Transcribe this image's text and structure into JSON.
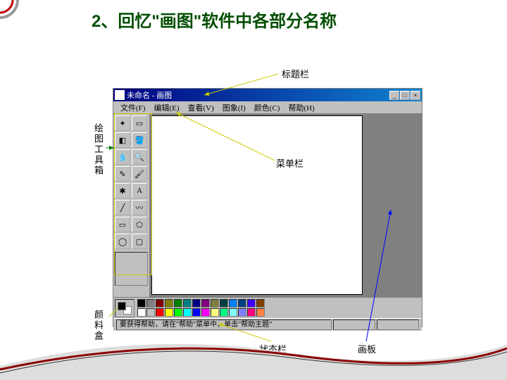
{
  "slide": {
    "title": "2、回忆\"画图\"软件中各部分名称"
  },
  "window": {
    "title": "未命名 - 画图"
  },
  "menu": {
    "file": "文件(F)",
    "edit": "编辑(E)",
    "view": "查看(V)",
    "image": "图象(I)",
    "color": "颜色(C)",
    "help": "帮助(H)"
  },
  "status": {
    "text": "要获得帮助，请在\"帮助\"菜单中，单击\"帮助主题\""
  },
  "annotations": {
    "titlebar": "标题栏",
    "menubar": "菜单栏",
    "toolbox": "绘图工具箱",
    "palette": "颜料盒",
    "statusbar": "状态栏",
    "canvas": "画板"
  },
  "palette_colors_row1": [
    "#000000",
    "#808080",
    "#800000",
    "#808000",
    "#008000",
    "#008080",
    "#000080",
    "#800080",
    "#808040",
    "#004040",
    "#0080ff",
    "#004080",
    "#4000ff",
    "#804000"
  ],
  "palette_colors_row2": [
    "#ffffff",
    "#c0c0c0",
    "#ff0000",
    "#ffff00",
    "#00ff00",
    "#00ffff",
    "#0000ff",
    "#ff00ff",
    "#ffff80",
    "#00ff80",
    "#80ffff",
    "#8080ff",
    "#ff0080",
    "#ff8040"
  ],
  "tools": [
    "freeform-select",
    "rect-select",
    "eraser",
    "fill",
    "picker",
    "magnify",
    "pencil",
    "brush",
    "airbrush",
    "text",
    "line",
    "curve",
    "rectangle",
    "polygon",
    "ellipse",
    "rounded-rect"
  ]
}
